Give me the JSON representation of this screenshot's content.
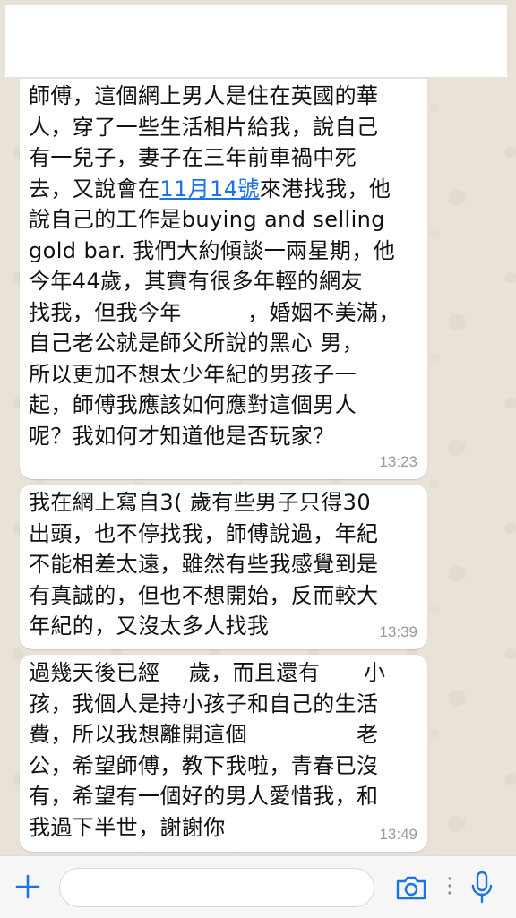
{
  "messages": [
    {
      "text_before_link": "師傅，這個網上男人是住在英國的華\n人，穿了一些生活相片給我，說自己\n有一兒子，妻子在三年前車禍中死\n去，又說會在",
      "link": "11月14號",
      "text_after_link": "來港找我，他\n說自己的工作是buying and selling\ngold bar. 我們大約傾談一兩星期，他\n今年44歲，其實有很多年輕的網友\n找我，但我今年　　　，婚姻不美滿，\n自己老公就是師父所說的黑心 男，\n所以更加不想太少年紀的男孩子一\n起，師傅我應該如何應對這個男人\n呢？我如何才知道他是否玩家？",
      "time": "13:23"
    },
    {
      "text": "我在網上寫自3( 歲有些男子只得30\n出頭，也不停找我，師傅說過，年紀\n不能相差太遠，雖然有些我感覺到是\n有真誠的，但也不想開始，反而較大\n年紀的，又沒太多人找我",
      "time": "13:39"
    },
    {
      "text": "過幾天後已經　 歲，而且還有　　小\n孩，我個人是持小孩子和自己的生活\n費，所以我想離開這個　　　　　老\n公，希望師傅，教下我啦，青春已沒\n有，希望有一個好的男人愛惜我，和\n我過下半世，謝謝你",
      "time": "13:49"
    }
  ],
  "input_bar": {
    "placeholder": "",
    "icons": [
      "plus-icon",
      "camera-icon",
      "more-dots-icon",
      "microphone-icon"
    ]
  },
  "colors": {
    "accent": "#1a73e8",
    "bubble": "#ffffff",
    "wallpaper": "#e9e2d9",
    "timestamp": "#9a9a9a"
  }
}
